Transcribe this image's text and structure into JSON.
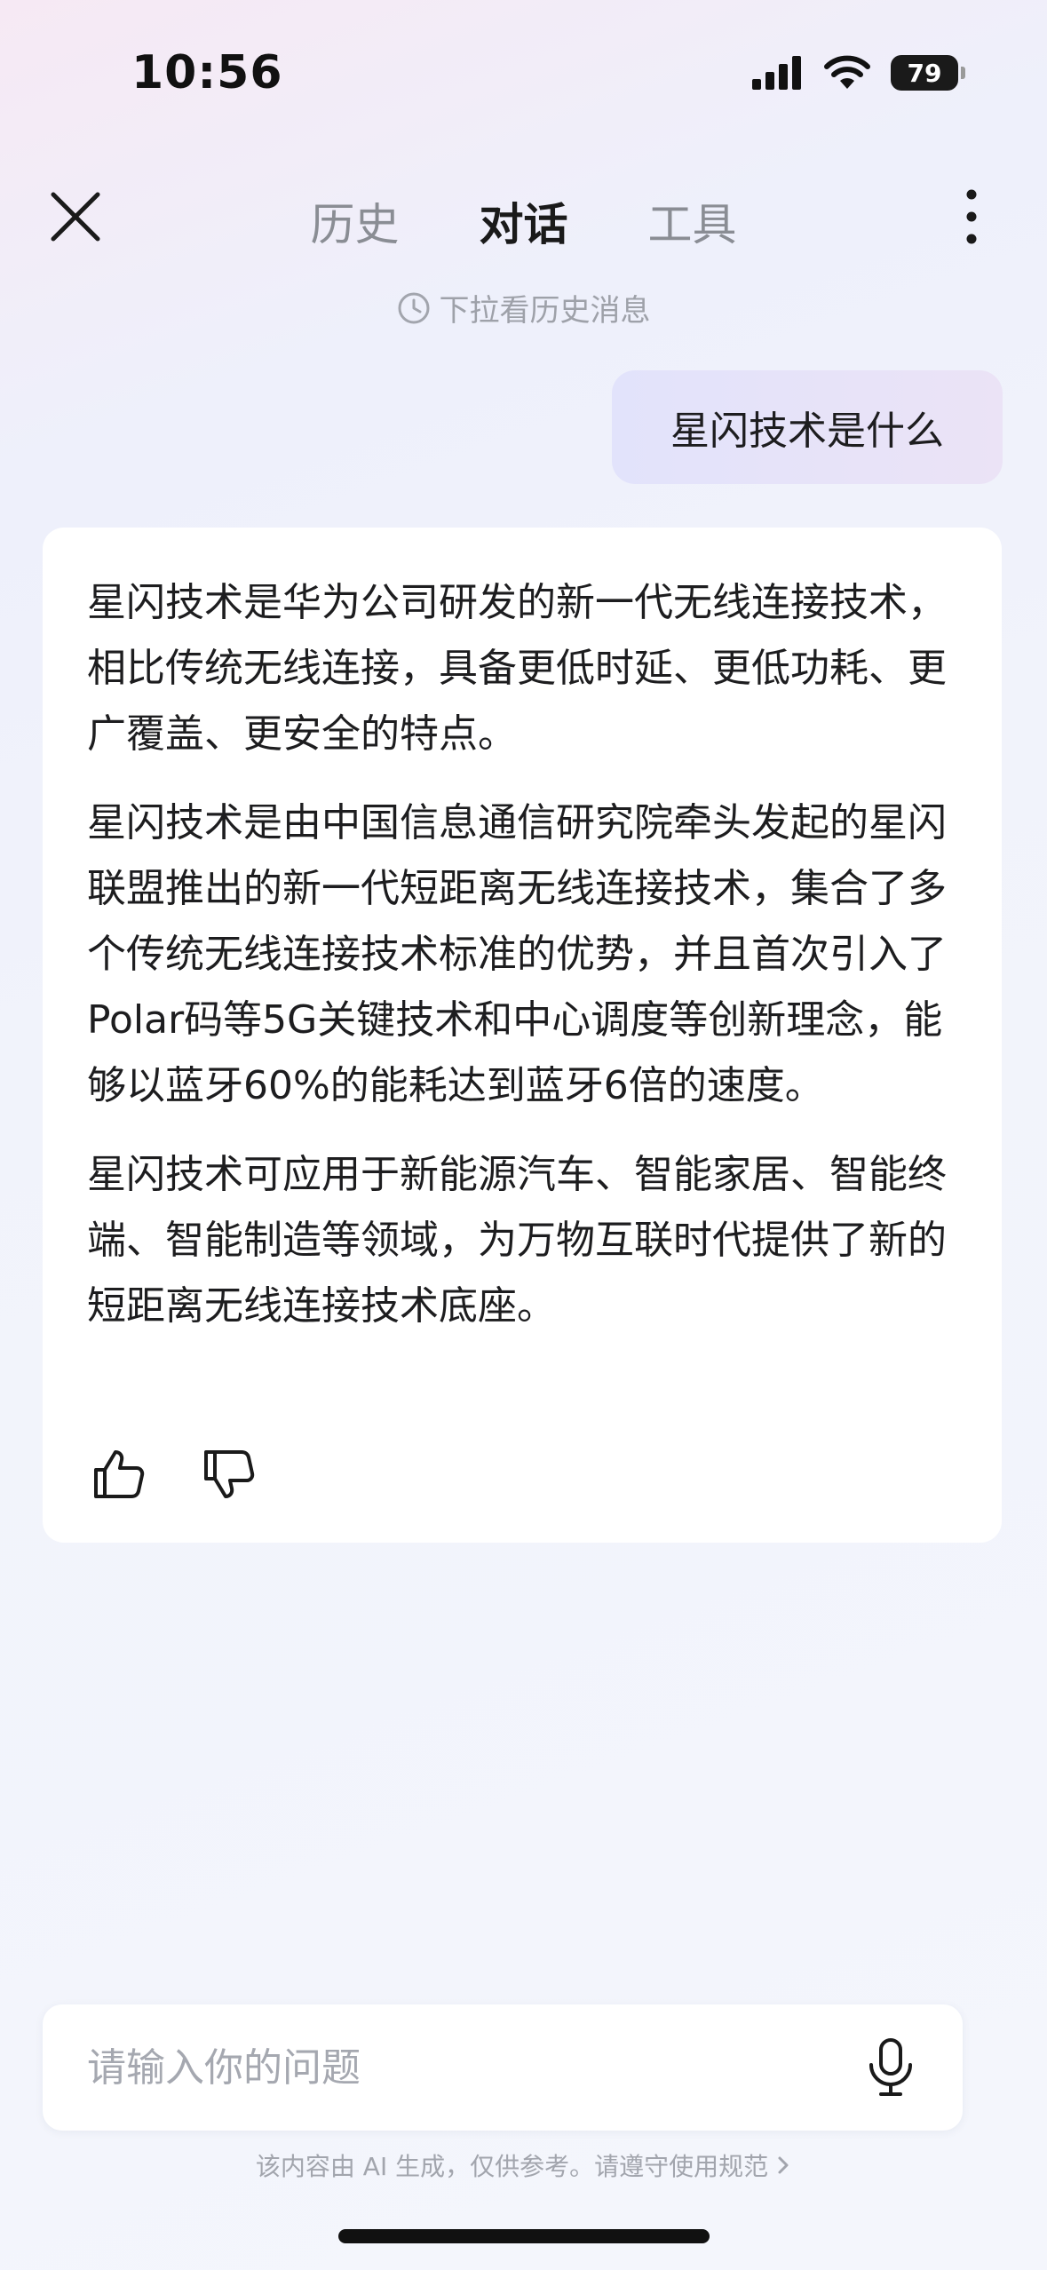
{
  "status_bar": {
    "time": "10:56",
    "battery": "79"
  },
  "nav": {
    "tabs": [
      {
        "label": "历史"
      },
      {
        "label": "对话"
      },
      {
        "label": "工具"
      }
    ],
    "active_tab": "对话"
  },
  "history_hint": "下拉看历史消息",
  "conversation": {
    "user_message": "星闪技术是什么",
    "answer_paragraphs": [
      "星闪技术是华为公司研发的新一代无线连接技术，相比传统无线连接，具备更低时延、更低功耗、更广覆盖、更安全的特点。",
      "星闪技术是由中国信息通信研究院牵头发起的星闪联盟推出的新一代短距离无线连接技术，集合了多个传统无线连接技术标准的优势，并且首次引入了Polar码等5G关键技术和中心调度等创新理念，能够以蓝牙60%的能耗达到蓝牙6倍的速度。",
      "星闪技术可应用于新能源汽车、智能家居、智能终端、智能制造等领域，为万物互联时代提供了新的短距离无线连接技术底座。"
    ]
  },
  "input": {
    "placeholder": "请输入你的问题",
    "value": ""
  },
  "disclaimer": "该内容由 AI 生成，仅供参考。请遵守使用规范",
  "colors": {
    "text_primary": "#1d1d1f",
    "text_muted": "#8a8d94",
    "user_bubble": "#e2e3fb",
    "card_bg": "#ffffff"
  }
}
